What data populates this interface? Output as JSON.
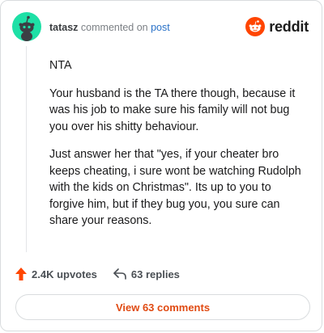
{
  "header": {
    "username": "tatasz",
    "commented": "commented on",
    "post_link": "post",
    "logo_text": "reddit",
    "brand_color": "#ff4500"
  },
  "comment": {
    "paragraphs": [
      "NTA",
      "Your husband is the TA there though, because it was his job to make sure his family will not bug you over his shitty behaviour.",
      "Just answer her that \"yes, if your cheater bro keeps cheating, i sure wont be watching Rudolph with the kids on Christmas\". Its up to you to forgive him, but if they bug you, you sure can share your reasons."
    ]
  },
  "actions": {
    "upvotes": "2.4K upvotes",
    "replies": "63 replies",
    "upvote_icon": "upvote-arrow-icon",
    "reply_icon": "reply-arrow-icon",
    "upvote_color": "#ff4500"
  },
  "footer": {
    "view_comments": "View 63 comments"
  }
}
